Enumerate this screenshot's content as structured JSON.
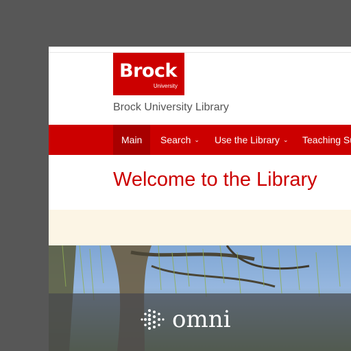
{
  "logo": {
    "word": "Brock",
    "sub": "University"
  },
  "site_name": "Brock University Library",
  "nav": {
    "items": [
      {
        "label": "Main",
        "dropdown": false,
        "active": true
      },
      {
        "label": "Search",
        "dropdown": true,
        "active": false
      },
      {
        "label": "Use the Library",
        "dropdown": true,
        "active": false
      },
      {
        "label": "Teaching Su",
        "dropdown": false,
        "active": false
      }
    ]
  },
  "main": {
    "heading": "Welcome to the Library"
  },
  "hero": {
    "omni_label": "omni"
  },
  "colors": {
    "brand_red": "#cc0000",
    "active_red": "#a80000",
    "banner": "#fcf5e5",
    "background": "#575757"
  }
}
